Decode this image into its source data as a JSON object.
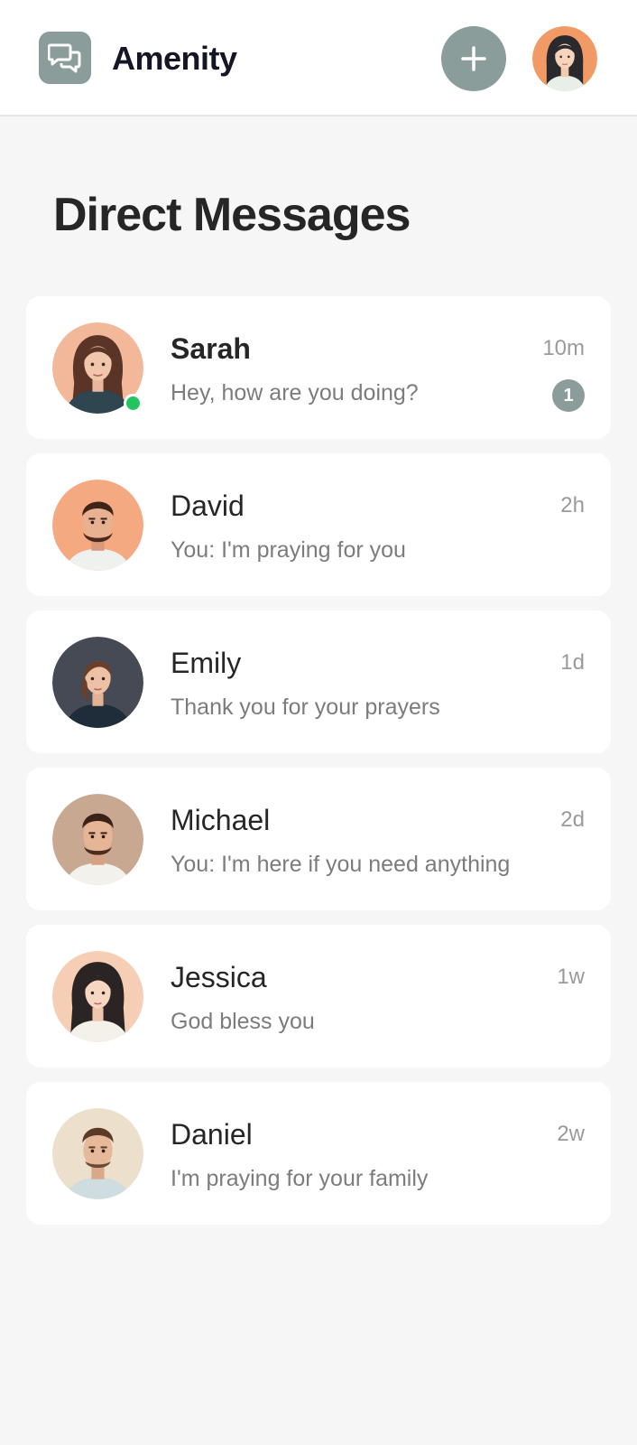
{
  "header": {
    "app_name": "Amenity",
    "logo_icon": "chat-bubbles-icon",
    "add_icon": "plus-icon",
    "profile_icon": "user-avatar"
  },
  "page": {
    "title": "Direct Messages"
  },
  "colors": {
    "accent": "#8a9d9b",
    "online": "#22c55e",
    "background": "#f6f6f6",
    "card": "#ffffff"
  },
  "conversations": [
    {
      "name": "Sarah",
      "preview": "Hey, how are you doing?",
      "time": "10m",
      "unread": "1",
      "online": true
    },
    {
      "name": "David",
      "preview": "You: I'm praying for you",
      "time": "2h"
    },
    {
      "name": "Emily",
      "preview": "Thank you for your prayers",
      "time": "1d"
    },
    {
      "name": "Michael",
      "preview": "You: I'm here if you need anything",
      "time": "2d"
    },
    {
      "name": "Jessica",
      "preview": "God bless you",
      "time": "1w"
    },
    {
      "name": "Daniel",
      "preview": "I'm praying for your family",
      "time": "2w"
    }
  ]
}
